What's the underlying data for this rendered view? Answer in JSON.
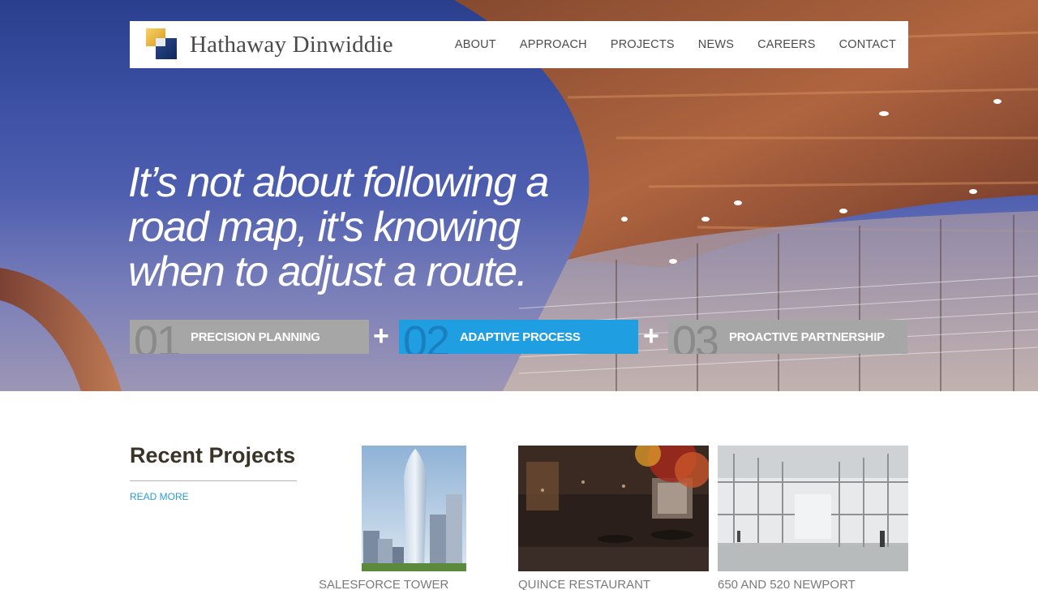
{
  "site": {
    "logo_text": "Hathaway Dinwiddie"
  },
  "nav": {
    "items": [
      {
        "label": "ABOUT"
      },
      {
        "label": "APPROACH"
      },
      {
        "label": "PROJECTS"
      },
      {
        "label": "NEWS"
      },
      {
        "label": "CAREERS"
      },
      {
        "label": "CONTACT"
      }
    ]
  },
  "hero": {
    "tagline_line1": "It’s not about following a",
    "tagline_line2": "road map, it's knowing",
    "tagline_line3": "when to adjust a route.",
    "steps": [
      {
        "number": "01",
        "label": "PRECISION PLANNING",
        "color": "#a6a6a6"
      },
      {
        "number": "02",
        "label": "ADAPTIVE PROCESS",
        "color": "#1f9ee2"
      },
      {
        "number": "03",
        "label": "PROACTIVE PARTNERSHIP",
        "color": "#a6a6a6"
      }
    ],
    "plus": "+"
  },
  "recent": {
    "title": "Recent Projects",
    "read_more": "READ MORE",
    "projects": [
      {
        "caption": "SALESFORCE TOWER"
      },
      {
        "caption": "QUINCE RESTAURANT"
      },
      {
        "caption": "650 AND 520 NEWPORT"
      }
    ]
  },
  "colors": {
    "accent_blue": "#1f9ee2",
    "step_gray": "#a6a6a6",
    "link_blue": "#2b9ad9"
  }
}
